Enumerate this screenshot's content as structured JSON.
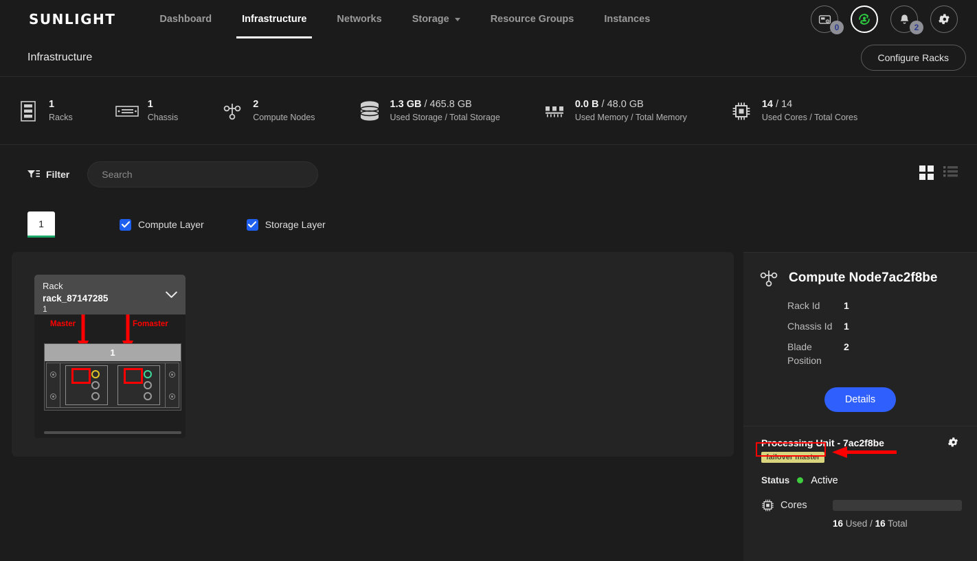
{
  "brand": {
    "logo": "SUNLIGHT"
  },
  "nav": {
    "items": [
      {
        "label": "Dashboard",
        "active": false,
        "caret": false
      },
      {
        "label": "Infrastructure",
        "active": true,
        "caret": false
      },
      {
        "label": "Networks",
        "active": false,
        "caret": false
      },
      {
        "label": "Storage",
        "active": false,
        "caret": true
      },
      {
        "label": "Resource Groups",
        "active": false,
        "caret": false
      },
      {
        "label": "Instances",
        "active": false,
        "caret": false
      }
    ],
    "actions": {
      "vm_badge": "0",
      "alerts_badge": "2",
      "vm_icon": "vm-screen-icon",
      "user_sync_icon": "user-sync-icon",
      "bell_icon": "bell-icon",
      "gear_icon": "gear-icon"
    }
  },
  "titlebar": {
    "title": "Infrastructure",
    "configure_racks_label": "Configure Racks"
  },
  "stats": [
    {
      "icon": "rack-icon",
      "value": "1",
      "unit": "",
      "sub": "Racks"
    },
    {
      "icon": "chassis-icon",
      "value": "1",
      "unit": "",
      "sub": "Chassis"
    },
    {
      "icon": "node-icon",
      "value": "2",
      "unit": "",
      "sub": "Compute Nodes"
    },
    {
      "icon": "storage-icon",
      "value": "1.3 GB",
      "unit": "/ 465.8 GB",
      "sub": "Used Storage / Total Storage"
    },
    {
      "icon": "memory-icon",
      "value": "0.0 B",
      "unit": "/ 48.0 GB",
      "sub": "Used Memory / Total Memory"
    },
    {
      "icon": "cpu-icon",
      "value": "14",
      "unit": "/ 14",
      "sub": "Used Cores / Total Cores"
    }
  ],
  "toolbar": {
    "filter_label": "Filter",
    "search_value": "",
    "search_placeholder": "Search",
    "grid_view_active": true,
    "list_view_active": false
  },
  "layers": {
    "rack_tab_label": "1",
    "checkboxes": [
      {
        "label": "Compute Layer",
        "checked": true
      },
      {
        "label": "Storage Layer",
        "checked": true
      }
    ]
  },
  "rack": {
    "kind_label": "Rack",
    "name": "rack_87147285",
    "index": "1",
    "chassis_label": "1",
    "annotations": {
      "master_label": "Master",
      "fomaster_label": "Fomaster"
    },
    "blades": [
      {
        "position": "1",
        "node_color": "#d9656b",
        "led_color": "#e3c427",
        "highlighted": true
      },
      {
        "position": "2",
        "node_color": "#3ed99a",
        "led_color": "#3ed99a",
        "highlighted": true
      }
    ]
  },
  "detail": {
    "title": "Compute Node7ac2f8be",
    "icon": "node-icon",
    "fields": [
      {
        "key": "Rack Id",
        "value": "1"
      },
      {
        "key": "Chassis Id",
        "value": "1"
      },
      {
        "key": "Blade Position",
        "value": "2"
      }
    ],
    "details_button": "Details",
    "processing_unit": {
      "title": "Processing Unit - 7ac2f8be",
      "badge": "failover master",
      "gear_icon": "gear-icon",
      "status_key": "Status",
      "status_value": "Active",
      "cores_label": "Cores",
      "cores_used": "16",
      "cores_used_suffix": "Used /",
      "cores_total": "16",
      "cores_total_suffix": "Total",
      "cores_percent": 100
    }
  },
  "colors": {
    "accent_blue": "#2f5ffc",
    "annotation_red": "#ff0000",
    "status_green": "#3fcc3f",
    "tab_underline_green": "#19a86a",
    "badge_yellow": "#d8d57e"
  }
}
